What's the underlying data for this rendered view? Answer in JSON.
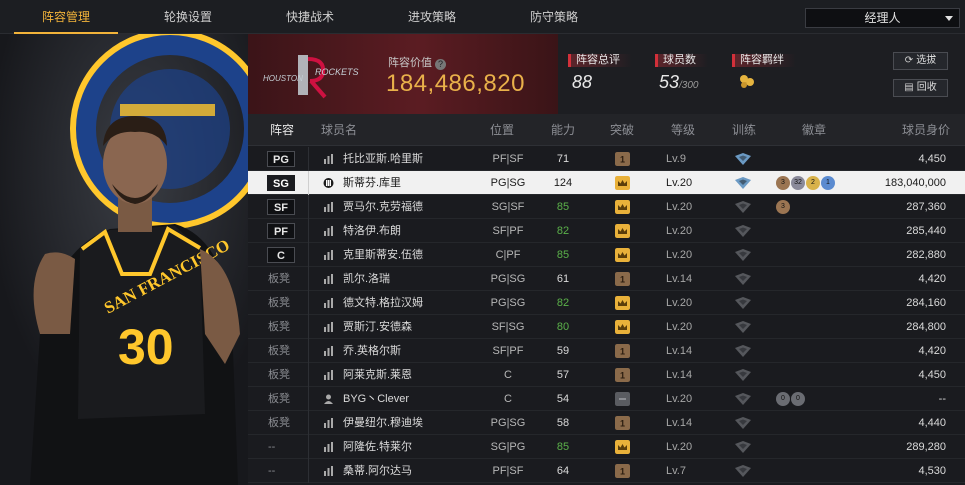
{
  "nav": {
    "tabs": [
      {
        "label": "阵容管理",
        "active": true
      },
      {
        "label": "轮换设置",
        "active": false
      },
      {
        "label": "快捷战术",
        "active": false
      },
      {
        "label": "进攻策略",
        "active": false
      },
      {
        "label": "防守策略",
        "active": false
      }
    ],
    "manager_select": "经理人"
  },
  "team": {
    "logo_text": "ROCKETS",
    "value_label": "阵容价值",
    "value": "184,486,820",
    "rating_label": "阵容总评",
    "rating": "88",
    "players_label": "球员数",
    "players_count": "53",
    "players_max": "/300",
    "bond_label": "阵容羁绊",
    "buttons": {
      "choose": "选拔",
      "recycle": "回收"
    }
  },
  "table": {
    "headers": [
      "阵容",
      "球员名",
      "位置",
      "能力",
      "突破",
      "等级",
      "训练",
      "徽章",
      "球员身价"
    ],
    "rows": [
      {
        "slot": "PG",
        "name": "托比亚斯.哈里斯",
        "position": "PF|SF",
        "ability": "71",
        "ability_color": "white",
        "break": "1",
        "level": "Lv.9",
        "train": "blue",
        "badges": [],
        "value": "4,450"
      },
      {
        "slot": "SG",
        "name": "斯蒂芬.库里",
        "position": "PG|SG",
        "ability": "124",
        "ability_color": "white",
        "break": "crown",
        "level": "Lv.20",
        "train": "blue",
        "badges": [
          "3",
          "32",
          "2",
          "1"
        ],
        "value": "183,040,000",
        "selected": true
      },
      {
        "slot": "SF",
        "name": "贾马尔.克劳福德",
        "position": "SG|SF",
        "ability": "85",
        "ability_color": "green",
        "break": "crown",
        "level": "Lv.20",
        "train": "grey",
        "badges": [
          "3"
        ],
        "value": "287,360"
      },
      {
        "slot": "PF",
        "name": "特洛伊.布朗",
        "position": "SF|PF",
        "ability": "82",
        "ability_color": "green",
        "break": "crown",
        "level": "Lv.20",
        "train": "grey",
        "badges": [],
        "value": "285,440"
      },
      {
        "slot": "C",
        "name": "克里斯蒂安.伍德",
        "position": "C|PF",
        "ability": "85",
        "ability_color": "green",
        "break": "crown",
        "level": "Lv.20",
        "train": "grey",
        "badges": [],
        "value": "282,880"
      },
      {
        "slot": "板凳",
        "name": "凯尔.洛瑞",
        "position": "PG|SG",
        "ability": "61",
        "ability_color": "white",
        "break": "1",
        "level": "Lv.14",
        "train": "grey",
        "badges": [],
        "value": "4,420"
      },
      {
        "slot": "板凳",
        "name": "德文特.格拉汉姆",
        "position": "PG|SG",
        "ability": "82",
        "ability_color": "green",
        "break": "crown",
        "level": "Lv.20",
        "train": "grey",
        "badges": [],
        "value": "284,160"
      },
      {
        "slot": "板凳",
        "name": "贾斯汀.安德森",
        "position": "SF|SG",
        "ability": "80",
        "ability_color": "green",
        "break": "crown",
        "level": "Lv.20",
        "train": "grey",
        "badges": [],
        "value": "284,800"
      },
      {
        "slot": "板凳",
        "name": "乔.英格尔斯",
        "position": "SF|PF",
        "ability": "59",
        "ability_color": "white",
        "break": "1",
        "level": "Lv.14",
        "train": "grey",
        "badges": [],
        "value": "4,420"
      },
      {
        "slot": "板凳",
        "name": "阿莱克斯.莱恩",
        "position": "C",
        "ability": "57",
        "ability_color": "white",
        "break": "1",
        "level": "Lv.14",
        "train": "grey",
        "badges": [],
        "value": "4,450"
      },
      {
        "slot": "板凳",
        "name": "BYG丶Clever",
        "position": "C",
        "ability": "54",
        "ability_color": "white",
        "break": "none",
        "level": "Lv.20",
        "train": "grey",
        "badges": [
          "0",
          "0"
        ],
        "value": "--",
        "person": true
      },
      {
        "slot": "板凳",
        "name": "伊曼纽尔.穆迪埃",
        "position": "PG|SG",
        "ability": "58",
        "ability_color": "white",
        "break": "1",
        "level": "Lv.14",
        "train": "grey",
        "badges": [],
        "value": "4,440"
      },
      {
        "slot": "--",
        "name": "阿隆佐.特莱尔",
        "position": "SG|PG",
        "ability": "85",
        "ability_color": "green",
        "break": "crown",
        "level": "Lv.20",
        "train": "grey",
        "badges": [],
        "value": "289,280"
      },
      {
        "slot": "--",
        "name": "桑蒂.阿尔达马",
        "position": "PF|SF",
        "ability": "64",
        "ability_color": "white",
        "break": "1",
        "level": "Lv.7",
        "train": "grey",
        "badges": [],
        "value": "4,530"
      }
    ]
  },
  "colors": {
    "accent": "#f2b33a",
    "gold": "#e9b14a",
    "red": "#d2303a",
    "green": "#5bb14a",
    "warriors_blue": "#1d428a",
    "warriors_gold": "#ffc72c"
  }
}
